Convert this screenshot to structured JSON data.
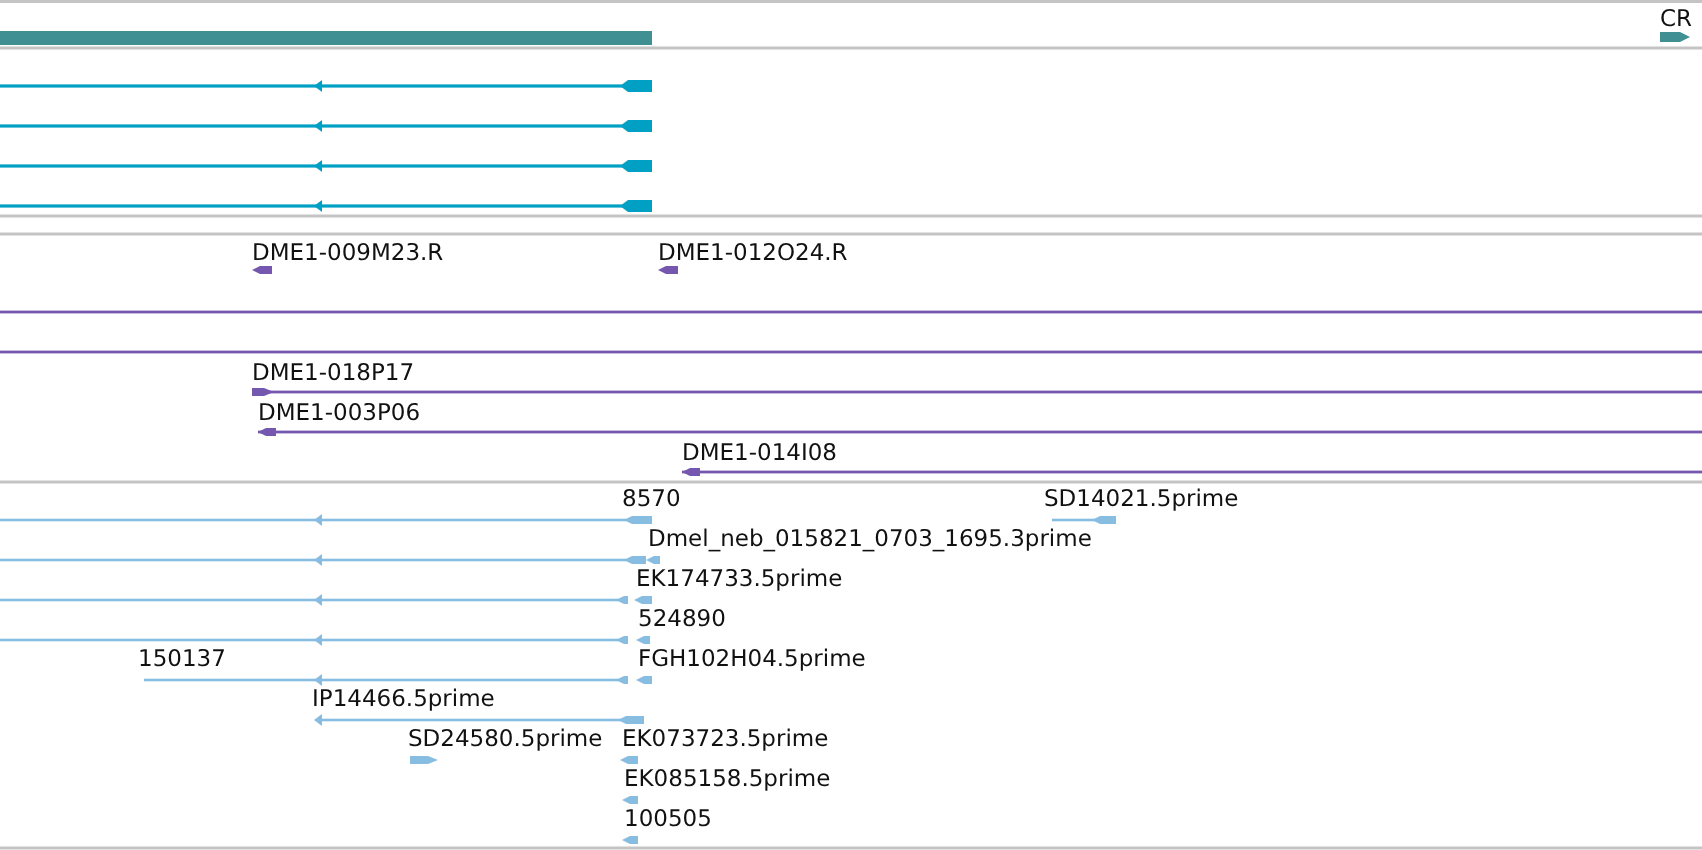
{
  "tracks": [
    {
      "kind": "gene",
      "color": "#3f8f93",
      "features": [
        {
          "kind": "plain"
        },
        {
          "label": "CR",
          "kind": "forward"
        }
      ]
    },
    {
      "kind": "transcript",
      "color": "#009fc4",
      "features": [
        {
          "kind": "reverse"
        },
        {
          "kind": "reverse"
        },
        {
          "kind": "reverse"
        },
        {
          "kind": "reverse"
        }
      ]
    },
    {
      "kind": "clone",
      "color": "#7657b0",
      "features": [
        {
          "label": "DME1-009M23.R",
          "kind": "reverse"
        },
        {
          "label": "DME1-012O24.R",
          "kind": "reverse"
        },
        {
          "kind": "plain"
        },
        {
          "kind": "plain"
        },
        {
          "label": "DME1-018P17",
          "kind": "forward"
        },
        {
          "label": "DME1-003P06",
          "kind": "reverse"
        },
        {
          "label": "DME1-014I08",
          "kind": "reverse"
        }
      ]
    },
    {
      "kind": "est",
      "color": "#86bde0",
      "features": [
        {
          "label": "8570",
          "kind": "reverse"
        },
        {
          "label": "SD14021.5prime",
          "kind": "reverse"
        },
        {
          "kind": "reverse"
        },
        {
          "label": "Dmel_neb_015821_0703_1695.3prime",
          "kind": "reverse"
        },
        {
          "kind": "reverse"
        },
        {
          "label": "EK174733.5prime",
          "kind": "reverse"
        },
        {
          "kind": "reverse"
        },
        {
          "label": "524890",
          "kind": "reverse"
        },
        {
          "label": "150137",
          "kind": "reverse"
        },
        {
          "label": "FGH102H04.5prime",
          "kind": "reverse"
        },
        {
          "label": "IP14466.5prime",
          "kind": "reverse"
        },
        {
          "label": "SD24580.5prime",
          "kind": "forward"
        },
        {
          "label": "EK073723.5prime",
          "kind": "reverse"
        },
        {
          "label": "EK085158.5prime",
          "kind": "reverse"
        },
        {
          "label": "100505",
          "kind": "reverse"
        }
      ]
    }
  ]
}
